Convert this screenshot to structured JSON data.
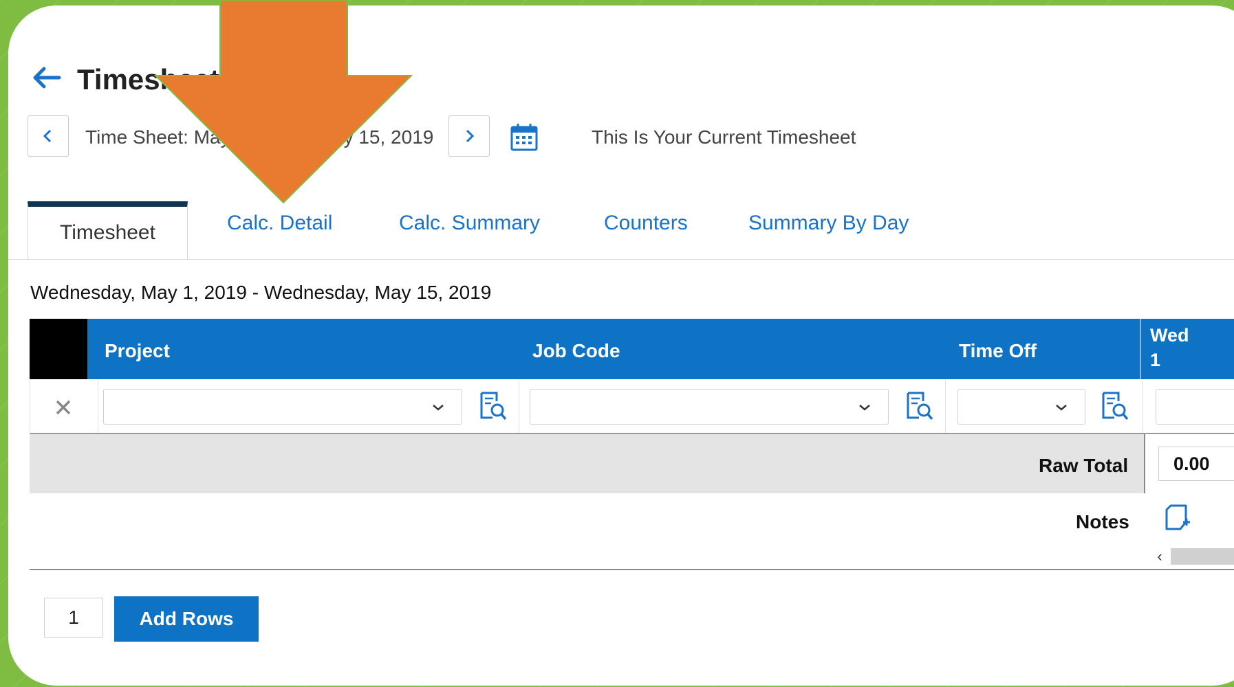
{
  "header": {
    "title": "Timesheet",
    "period_label": "Time Sheet: May 1, 2019 - May 15, 2019",
    "current_note": "This Is Your Current Timesheet"
  },
  "tabs": [
    {
      "label": "Timesheet",
      "active": true
    },
    {
      "label": "Calc. Detail"
    },
    {
      "label": "Calc. Summary"
    },
    {
      "label": "Counters"
    },
    {
      "label": "Summary By Day"
    }
  ],
  "date_range": "Wednesday, May 1, 2019 - Wednesday, May 15, 2019",
  "table": {
    "columns": [
      "Project",
      "Job Code",
      "Time Off"
    ],
    "day_column": {
      "weekday": "Wed",
      "day": "1"
    },
    "raw_total_label": "Raw Total",
    "raw_total_value": "0.00",
    "notes_label": "Notes"
  },
  "add_rows": {
    "count": "1",
    "button_label": "Add Rows"
  },
  "colors": {
    "accent": "#0f73c5",
    "overlay_arrow": "#e97b30",
    "frame": "#7fbd42"
  }
}
